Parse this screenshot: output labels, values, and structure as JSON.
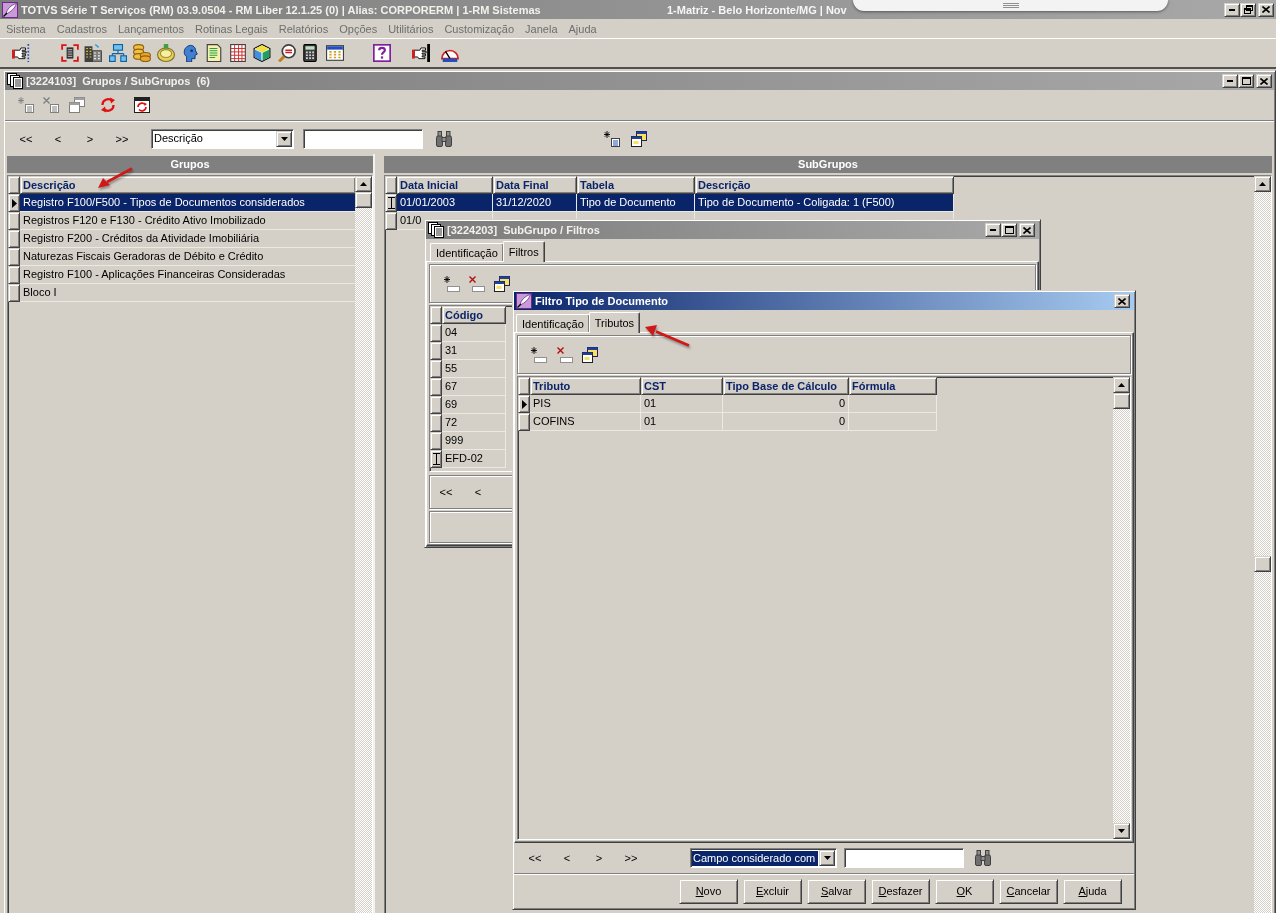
{
  "app_window": {
    "title": "TOTVS Série T Serviços (RM) 03.9.0504 - RM Liber 12.1.25 (0) | Alias: CORPORERM | 1-RM Sistemas",
    "context": "1-Matriz - Belo Horizonte/MG | Nov",
    "active": false
  },
  "menu": [
    "Sistema",
    "Cadastros",
    "Lançamentos",
    "Rotinas Legais",
    "Relatórios",
    "Opções",
    "Utilitários",
    "Customização",
    "Janela",
    "Ajuda"
  ],
  "groups_window": {
    "title": "[3224103]  Grupos / SubGrupos  (6)",
    "active": false,
    "nav": [
      "<<",
      "<",
      ">",
      ">>"
    ],
    "search": {
      "field": "Descrição",
      "focused": false
    },
    "groups": {
      "header": "Grupos",
      "columns": [
        "Descrição"
      ],
      "rows": [
        {
          "cells": [
            "Registro F100/F500 - Tipos de Documentos considerados"
          ],
          "selected": true,
          "current": true,
          "editing": false
        },
        {
          "cells": [
            "Registros F120 e F130 - Crédito Ativo Imobilizado"
          ],
          "selected": false,
          "current": false,
          "editing": false
        },
        {
          "cells": [
            "Registro F200 - Créditos da Atividade Imobiliária"
          ],
          "selected": false,
          "current": false,
          "editing": false
        },
        {
          "cells": [
            "Naturezas Fiscais Geradoras de Débito e Crédito"
          ],
          "selected": false,
          "current": false,
          "editing": false
        },
        {
          "cells": [
            "Registro F100 - Aplicações Financeiras Consideradas"
          ],
          "selected": false,
          "current": false,
          "editing": false
        },
        {
          "cells": [
            "Bloco I"
          ],
          "selected": false,
          "current": false,
          "editing": false
        }
      ]
    },
    "subgroups": {
      "header": "SubGrupos",
      "columns": [
        "Data Inicial",
        "Data Final",
        "Tabela",
        "Descrição"
      ],
      "rows": [
        {
          "cells": [
            "01/01/2003",
            "31/12/2020",
            "Tipo de Documento",
            "Tipo de Documento - Coligada: 1 (F500)"
          ],
          "selected": true,
          "current": true,
          "editing": true
        },
        {
          "cells": [
            "01/0"
          ],
          "selected": false,
          "current": false,
          "editing": false
        }
      ]
    }
  },
  "filters_window": {
    "title": "[3224203]  SubGrupo / Filtros",
    "active": false,
    "tabs": [
      {
        "label": "Identificação",
        "selected": false
      },
      {
        "label": "Filtros",
        "selected": true
      }
    ],
    "table": {
      "columns": [
        "Código"
      ],
      "rows": [
        {
          "cells": [
            "04"
          ],
          "selected": false,
          "current": false,
          "editing": false
        },
        {
          "cells": [
            "31"
          ],
          "selected": false,
          "current": false,
          "editing": false
        },
        {
          "cells": [
            "55"
          ],
          "selected": false,
          "current": false,
          "editing": false
        },
        {
          "cells": [
            "67"
          ],
          "selected": false,
          "current": false,
          "editing": false
        },
        {
          "cells": [
            "69"
          ],
          "selected": false,
          "current": false,
          "editing": false
        },
        {
          "cells": [
            "72"
          ],
          "selected": false,
          "current": false,
          "editing": false
        },
        {
          "cells": [
            "999"
          ],
          "selected": false,
          "current": false,
          "editing": false
        },
        {
          "cells": [
            "EFD-02"
          ],
          "selected": false,
          "current": true,
          "editing": true
        }
      ]
    },
    "nav": [
      "<<",
      "<"
    ]
  },
  "filter_dialog": {
    "title": "Filtro Tipo de Documento",
    "active": true,
    "tabs": [
      {
        "label": "Identificação",
        "selected": false
      },
      {
        "label": "Tributos",
        "selected": true
      }
    ],
    "table": {
      "columns": [
        "Tributo",
        "CST",
        "Tipo Base de Cálculo",
        "Fórmula"
      ],
      "rows": [
        {
          "cells": [
            "PIS",
            "01",
            "0"
          ],
          "selected": false,
          "current": true,
          "editing": false
        },
        {
          "cells": [
            "COFINS",
            "01",
            "0"
          ],
          "selected": false,
          "current": false,
          "editing": false
        }
      ]
    },
    "nav": [
      "<<",
      "<",
      ">",
      ">>"
    ],
    "search": {
      "field": "Campo considerado com",
      "focused": true
    },
    "buttons": [
      "Novo",
      "Excluir",
      "Salvar",
      "Desfazer",
      "OK",
      "Cancelar",
      "Ajuda"
    ]
  }
}
